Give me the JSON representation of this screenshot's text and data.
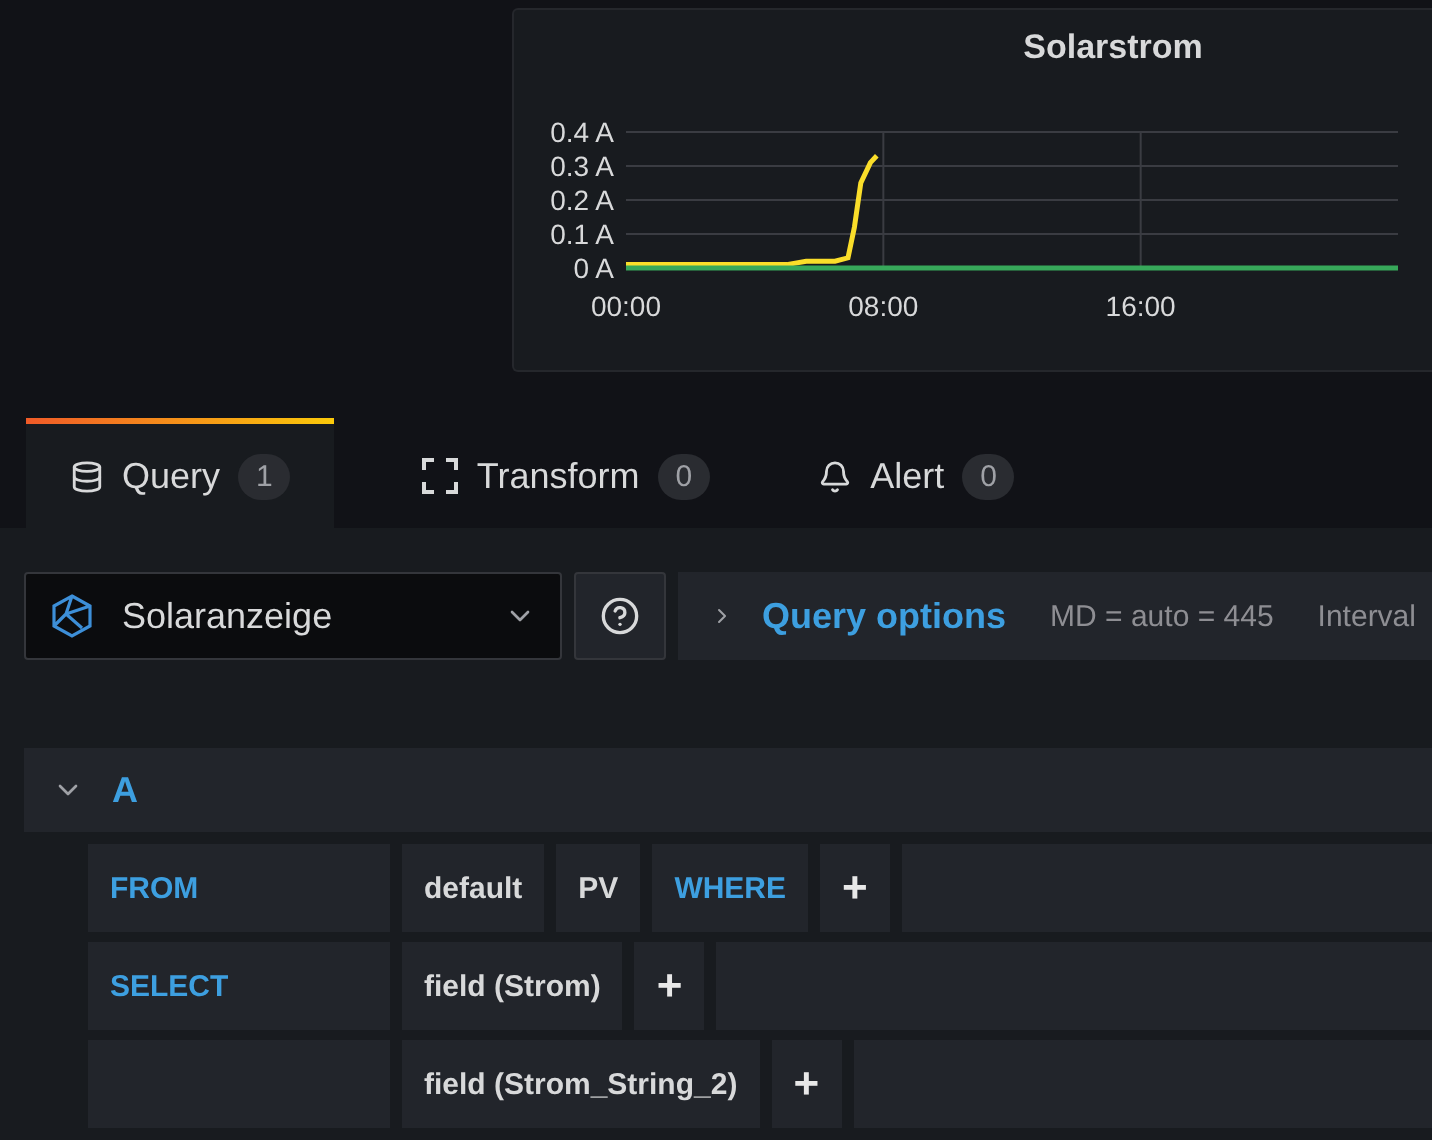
{
  "panel": {
    "title": "Solarstrom",
    "chart_data": {
      "type": "line",
      "x": [
        0,
        1,
        2,
        3,
        4,
        5,
        5.6,
        6,
        6.5,
        6.9,
        7.1,
        7.3,
        7.6,
        7.8,
        24
      ],
      "grid": true,
      "series": [
        {
          "color": "#fade2a",
          "values": [
            0.01,
            0.01,
            0.01,
            0.01,
            0.01,
            0.01,
            0.02,
            0.02,
            0.02,
            0.03,
            0.12,
            0.25,
            0.31,
            0.33,
            null
          ]
        },
        {
          "color": "#37a85a",
          "values": [
            0,
            0,
            0,
            0,
            0,
            0,
            0,
            0,
            0,
            0,
            0,
            0,
            0,
            0,
            0
          ]
        }
      ],
      "xlim": [
        0,
        24
      ],
      "ylim": [
        0,
        0.4
      ],
      "xticks": [
        {
          "value": 0,
          "label": "00:00"
        },
        {
          "value": 8,
          "label": "08:00"
        },
        {
          "value": 16,
          "label": "16:00"
        }
      ],
      "yticks": [
        {
          "value": 0,
          "label": "0 A"
        },
        {
          "value": 0.1,
          "label": "0.1 A"
        },
        {
          "value": 0.2,
          "label": "0.2 A"
        },
        {
          "value": 0.3,
          "label": "0.3 A"
        },
        {
          "value": 0.4,
          "label": "0.4 A"
        }
      ]
    }
  },
  "tabs": [
    {
      "kind": "database",
      "label": "Query",
      "count": "1",
      "selected": true
    },
    {
      "kind": "transform",
      "label": "Transform",
      "count": "0",
      "selected": false
    },
    {
      "kind": "bell",
      "label": "Alert",
      "count": "0",
      "selected": false
    }
  ],
  "datasource": {
    "value": "Solaranzeige"
  },
  "query_options": {
    "label": "Query options",
    "summary": [
      "MD = auto = 445",
      "Interval"
    ]
  },
  "query": {
    "name": "A",
    "expanded": true,
    "rows": [
      {
        "label": "FROM",
        "parts": [
          {
            "text": "default",
            "kind": "value"
          },
          {
            "text": "PV",
            "kind": "value"
          },
          {
            "text": "WHERE",
            "kind": "keyword"
          },
          {
            "text": "+",
            "kind": "add"
          }
        ]
      },
      {
        "label": "SELECT",
        "parts": [
          {
            "text": "field (Strom)",
            "kind": "value"
          },
          {
            "text": "+",
            "kind": "add"
          }
        ]
      },
      {
        "label": "",
        "parts": [
          {
            "text": "field (Strom_String_2)",
            "kind": "value"
          },
          {
            "text": "+",
            "kind": "add"
          }
        ]
      }
    ]
  }
}
